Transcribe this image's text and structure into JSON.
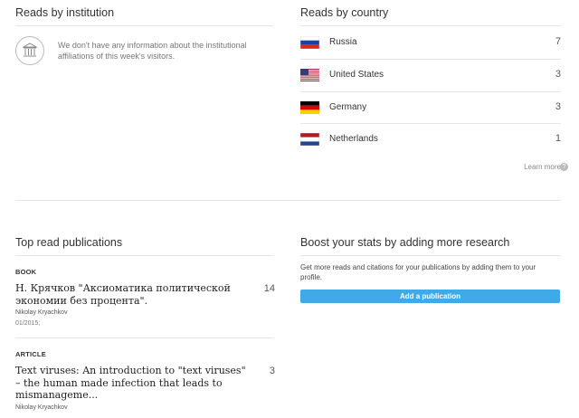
{
  "institution": {
    "title": "Reads by institution",
    "message": "We don't have any information about the institutional affiliations of this week's visitors."
  },
  "country": {
    "title": "Reads by country",
    "rows": [
      {
        "name": "Russia",
        "count": "7"
      },
      {
        "name": "United States",
        "count": "3"
      },
      {
        "name": "Germany",
        "count": "3"
      },
      {
        "name": "Netherlands",
        "count": "1"
      }
    ],
    "learn_more": "Learn more"
  },
  "top_read": {
    "title": "Top read publications",
    "items": [
      {
        "type": "BOOK",
        "title": "Н. Крячков \"Аксиоматика политической экономии без процента\".",
        "author": "Nikolay Kryachkov",
        "date": "01/2015;",
        "reads": "14"
      },
      {
        "type": "ARTICLE",
        "title": "Text viruses: An introduction to \"text viruses\" – the human made infection that leads to mismanageme...",
        "author": "Nikolay Kryachkov",
        "reads": "3"
      }
    ]
  },
  "boost": {
    "title": "Boost your stats by adding more research",
    "text": "Get more reads and citations for your publications by adding them to your profile.",
    "button": "Add a publication"
  },
  "colors": {
    "accent": "#40a9e8"
  }
}
